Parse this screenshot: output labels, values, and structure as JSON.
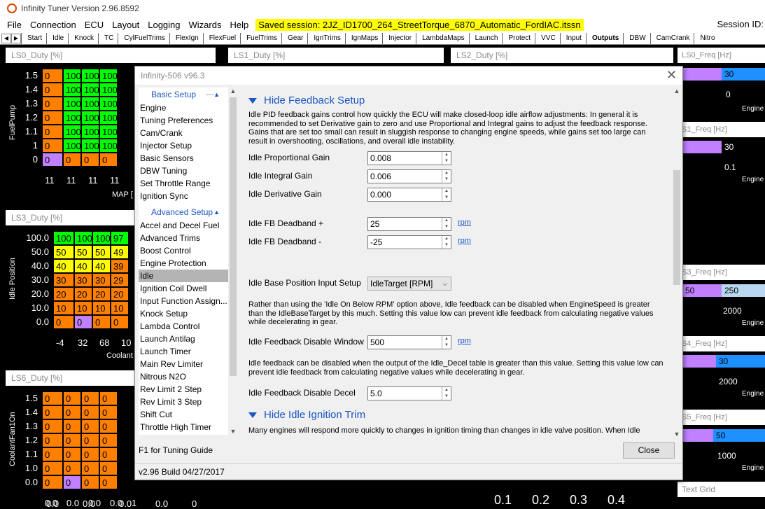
{
  "app": {
    "title": "Infinity Tuner Version 2.96.8592"
  },
  "menu": [
    "File",
    "Connection",
    "ECU",
    "Layout",
    "Logging",
    "Wizards",
    "Help"
  ],
  "session": {
    "saved": "Saved session: 2JZ_ID1700_264_StreetTorque_6870_Automatic_FordIAC.itssn",
    "id_label": "Session ID:"
  },
  "tabs": [
    "Start",
    "Idle",
    "Knock",
    "TC",
    "CylFuelTrims",
    "FlexIgn",
    "FlexFuel",
    "FuelTrims",
    "Gear",
    "IgnTrims",
    "IgnMaps",
    "Injector",
    "LambdaMaps",
    "Launch",
    "Protect",
    "VVC",
    "Input",
    "Outputs",
    "DBW",
    "CamCrank",
    "Nitro"
  ],
  "active_tab": "Outputs",
  "panels": {
    "ls0": {
      "title": "LS0_Duty [%]",
      "axis_label": "FuelPump",
      "x_label": "MAP [",
      "rows": [
        "1.5",
        "1.4",
        "1.3",
        "1.2",
        "1.1",
        "1",
        "0"
      ],
      "cells": [
        [
          "0",
          "100",
          "100",
          "100"
        ],
        [
          "0",
          "100",
          "100",
          "100"
        ],
        [
          "0",
          "100",
          "100",
          "100"
        ],
        [
          "0",
          "100",
          "100",
          "100"
        ],
        [
          "0",
          "100",
          "100",
          "100"
        ],
        [
          "0",
          "100",
          "100",
          "100"
        ],
        [
          "0",
          "0",
          "0",
          "0"
        ]
      ],
      "x_ticks": [
        "11",
        "11",
        "11",
        "11"
      ]
    },
    "ls1": {
      "title": "LS1_Duty [%]"
    },
    "ls2": {
      "title": "LS2_Duty [%]"
    },
    "ls3": {
      "title": "LS3_Duty [%]",
      "axis_label": "Idle Position",
      "x_label": "Coolant",
      "rows": [
        "100.0",
        "50.0",
        "40.0",
        "30.0",
        "20.0",
        "10.0",
        "0.0"
      ],
      "cells": [
        [
          "100",
          "100",
          "100",
          "97"
        ],
        [
          "50",
          "50",
          "50",
          "49"
        ],
        [
          "40",
          "40",
          "40",
          "39"
        ],
        [
          "30",
          "30",
          "30",
          "29"
        ],
        [
          "20",
          "20",
          "20",
          "20"
        ],
        [
          "10",
          "10",
          "10",
          "10"
        ],
        [
          "0",
          "0",
          "0",
          "0"
        ]
      ],
      "x_ticks": [
        "-4",
        "32",
        "68",
        "10"
      ]
    },
    "ls6": {
      "title": "LS6_Duty [%]",
      "axis_label": "CoolantFan1On",
      "rows": [
        "1.5",
        "1.4",
        "1.3",
        "1.2",
        "1.1",
        "1.0",
        "0.0"
      ],
      "cells": [
        [
          "0",
          "0",
          "0",
          "0"
        ],
        [
          "0",
          "0",
          "0",
          "0"
        ],
        [
          "0",
          "0",
          "0",
          "0"
        ],
        [
          "0",
          "0",
          "0",
          "0"
        ],
        [
          "0",
          "0",
          "0",
          "0"
        ],
        [
          "0",
          "0",
          "0",
          "0"
        ],
        [
          "0",
          "0",
          "0",
          "0"
        ]
      ],
      "x_ticks": [
        "0.0",
        "0.0",
        "0.0",
        "0.0",
        "1"
      ]
    },
    "right": {
      "ls0_freq": "LS0_Freq [Hz]",
      "v30a": "30",
      "v0": "0",
      "engine1": "Engine",
      "ls1_freq": "S1_Freq [Hz]",
      "v30b": "30",
      "v01": "0.1",
      "engine2": "Engine",
      "ls3_freq": "S3_Freq [Hz]",
      "v250": "250",
      "v50": "50",
      "v2000a": "2000",
      "engine3": "Engine",
      "ls4_freq": "S4_Freq [Hz]",
      "v30c": "30",
      "v2000b": "2000",
      "engine4": "Engine",
      "ls5_freq": "S5_Freq [Hz]",
      "v50b": "50",
      "v1000": "1000",
      "engine5": "Engine",
      "text_grid": "Text Grid"
    },
    "bottom_ticks": [
      "0.0",
      "0.0",
      "0.0",
      "0.0",
      "0",
      "0.1",
      "0.2",
      "0.3",
      "0.4"
    ]
  },
  "dialog": {
    "title": "Infinity-506 v96.3",
    "nav": {
      "basic_header": "Basic Setup",
      "basic_items": [
        "Engine",
        "Tuning Preferences",
        "Cam/Crank",
        "Injector Setup",
        "Basic Sensors",
        "DBW Tuning",
        "Set Throttle Range",
        "Ignition Sync"
      ],
      "advanced_header": "Advanced Setup",
      "advanced_items": [
        "Accel and Decel Fuel",
        "Advanced Trims",
        "Boost Control",
        "Engine Protection",
        "Idle",
        "Ignition Coil Dwell",
        "Input Function Assign...",
        "Knock Setup",
        "Lambda Control",
        "Launch Antilag",
        "Launch Timer",
        "Main Rev Limiter",
        "Nitrous N2O",
        "Rev Limit 2 Step",
        "Rev Limit 3 Step",
        "Shift Cut",
        "Throttle High Timer"
      ],
      "selected": "Idle"
    },
    "section1": "Hide Feedback Setup",
    "desc1": "Idle PID feedback gains control how quickly the ECU will make closed-loop idle airflow adjustments: In general it is recommended to set Derivative gain to zero and use Proportional and Integral gains to adjust the feedback response. Gains that are set too small can result in sluggish response to changing engine speeds, while gains set too large can result in overshooting, oscillations, and overall idle instability.",
    "fields": {
      "prop_label": "Idle Proportional Gain",
      "prop_value": "0.008",
      "int_label": "Idle Integral Gain",
      "int_value": "0.006",
      "der_label": "Idle Derivative Gain",
      "der_value": "0.000",
      "dbp_label": "Idle FB Deadband +",
      "dbp_value": "25",
      "dbm_label": "Idle FB Deadband -",
      "dbm_value": "-25",
      "base_label": "Idle Base Position Input Setup",
      "base_value": "IdleTarget [RPM]",
      "win_label": "Idle Feedback Disable Window",
      "win_value": "500",
      "dec_label": "Idle Feedback Disable Decel",
      "dec_value": "5.0",
      "unit": "rpm"
    },
    "desc2": "Rather than using the 'Idle On Below RPM' option above, Idle feedback can be disabled when EngineSpeed is greater than the IdleBaseTarget by this much. Setting this value low can prevent idle feedback from calculating negative values while decelerating in gear.",
    "desc3": "Idle feedback can be disabled when the output of the Idle_Decel table is greater than this value. Setting this value low can prevent idle feedback from calculating negative values while decelerating in gear.",
    "section2": "Hide Idle Ignition Trim",
    "desc4": "Many engines will respond more quickly to changes in ignition timing than changes in idle valve position. When Idle",
    "f1": "F1 for Tuning Guide",
    "close": "Close",
    "build": "v2.96 Build 04/27/2017"
  },
  "colors": {
    "orange": "#ff8000",
    "green": "#00ff00",
    "yellow": "#ffff00",
    "purple": "#c080ff",
    "blue": "#1e90ff",
    "lightblue": "#b8d8f0",
    "link": "#1a56c4"
  }
}
